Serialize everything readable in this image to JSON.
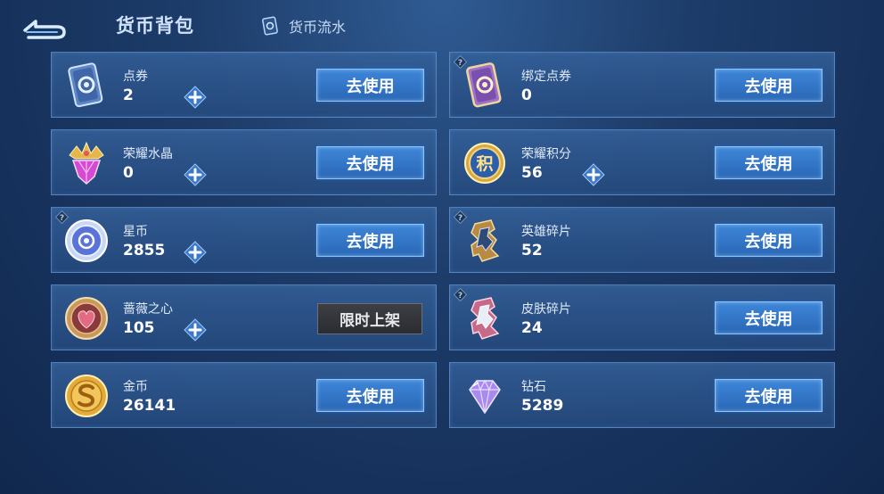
{
  "header": {
    "title": "货币背包",
    "flow_label": "货币流水"
  },
  "currencies": [
    {
      "name": "点券",
      "amount": "2",
      "button": "去使用",
      "icon": "coupon-card-icon"
    },
    {
      "name": "绑定点券",
      "amount": "0",
      "button": "去使用",
      "icon": "bound-coupon-card-icon"
    },
    {
      "name": "荣耀水晶",
      "amount": "0",
      "button": "去使用",
      "icon": "glory-crystal-icon"
    },
    {
      "name": "荣耀积分",
      "amount": "56",
      "button": "去使用",
      "icon": "glory-points-icon",
      "icon_glyph": "积"
    },
    {
      "name": "星币",
      "amount": "2855",
      "button": "去使用",
      "icon": "star-coin-icon"
    },
    {
      "name": "英雄碎片",
      "amount": "52",
      "button": "去使用",
      "icon": "hero-shard-icon"
    },
    {
      "name": "蔷薇之心",
      "amount": "105",
      "button": "限时上架",
      "icon": "rose-heart-icon"
    },
    {
      "name": "皮肤碎片",
      "amount": "24",
      "button": "去使用",
      "icon": "skin-shard-icon"
    },
    {
      "name": "金币",
      "amount": "26141",
      "button": "去使用",
      "icon": "gold-coin-icon"
    },
    {
      "name": "钻石",
      "amount": "5289",
      "button": "去使用",
      "icon": "diamond-icon"
    }
  ],
  "colors": {
    "background": "#1d3c69",
    "card": "#2f5a92",
    "button": "#2f72c4",
    "limited_button": "#33353a"
  }
}
